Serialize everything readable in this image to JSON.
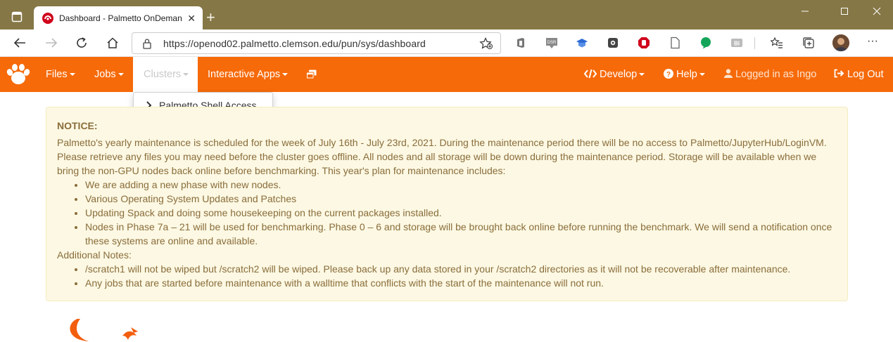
{
  "browser": {
    "tab_title": "Dashboard - Palmetto OnDeman",
    "new_tab_glyph": "+",
    "close_glyph": "✕",
    "url": "https://openod02.palmetto.clemson.edu/pun/sys/dashboard",
    "window_controls": [
      "minimize",
      "maximize",
      "close"
    ]
  },
  "navbar": {
    "color": "#f66a0a",
    "items": [
      {
        "label": "Files"
      },
      {
        "label": "Jobs"
      },
      {
        "label": "Clusters"
      },
      {
        "label": "Interactive Apps"
      }
    ],
    "right_items": [
      {
        "label": "Develop"
      },
      {
        "label": "Help"
      },
      {
        "label": "Logged in as Ingo"
      },
      {
        "label": "Log Out"
      }
    ]
  },
  "clusters_dropdown": {
    "items": [
      {
        "label": "Palmetto Shell Access",
        "icon": "terminal-icon"
      }
    ]
  },
  "notice": {
    "heading": "NOTICE:",
    "intro": "Palmetto's yearly maintenance is scheduled for the week of July 16th - July 23rd, 2021. During the maintenance period there will be no access to Palmetto/JupyterHub/LoginVM. Please retrieve any files you may need before the cluster goes offline. All nodes and all storage will be down during the maintenance period. Storage will be available when we bring the non-GPU nodes back online before benchmarking. This year's plan for maintenance includes:",
    "plan_items": [
      "We are adding a new phase with new nodes.",
      "Various Operating System Updates and Patches",
      "Updating Spack and doing some housekeeping on the current packages installed.",
      "Nodes in Phase 7a – 21 will be used for benchmarking. Phase 0 – 6 and storage will be brought back online before running the benchmark. We will send a notification once these systems are online and available."
    ],
    "additional_heading": "Additional Notes:",
    "additional_items": [
      "/scratch1 will not be wiped but /scratch2 will be wiped. Please back up any data stored in your /scratch2 directories as it will not be recoverable after maintenance.",
      "Any jobs that are started before maintenance with a walltime that conflicts with the start of the maintenance will not run."
    ]
  }
}
